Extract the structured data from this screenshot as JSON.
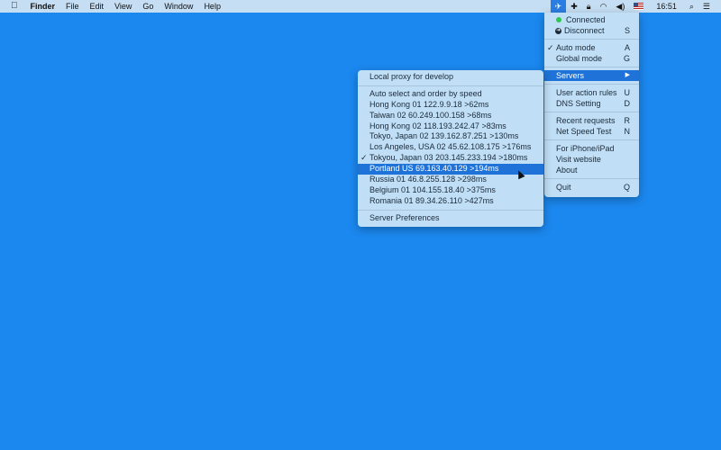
{
  "menubar": {
    "apple": "",
    "app": "Finder",
    "items": [
      "File",
      "Edit",
      "View",
      "Go",
      "Window",
      "Help"
    ],
    "clock": "16:51"
  },
  "status_icons": [
    "shadowsocks-icon",
    "plus-icon",
    "lock-icon",
    "wifi-icon",
    "volume-icon",
    "us-flag-icon",
    "search-icon",
    "list-icon"
  ],
  "main_menu": {
    "connected": "Connected",
    "disconnect": "Disconnect",
    "disconnect_key": "S",
    "auto_mode": "Auto mode",
    "auto_key": "A",
    "global_mode": "Global mode",
    "global_key": "G",
    "servers": "Servers",
    "user_rules": "User action rules",
    "user_key": "U",
    "dns": "DNS Setting",
    "dns_key": "D",
    "recent": "Recent requests",
    "recent_key": "R",
    "speed": "Net Speed Test",
    "speed_key": "N",
    "iphone": "For iPhone/iPad",
    "website": "Visit website",
    "about": "About",
    "quit": "Quit",
    "quit_key": "Q"
  },
  "sub_menu": {
    "local": "Local proxy for develop",
    "auto": "Auto select and order by speed",
    "servers": [
      "Hong Kong 01  122.9.9.18  >62ms",
      "Taiwan 02  60.249.100.158  >68ms",
      "Hong Kong 02  118.193.242.47  >83ms",
      "Tokyo, Japan 02  139.162.87.251  >130ms",
      "Los Angeles, USA 02  45.62.108.175  >176ms",
      "Tokyou, Japan 03  203.145.233.194  >180ms",
      "Portland US  69.163.40.129  >194ms",
      "Russia 01  46.8.255.128  >298ms",
      "Belgium 01  104.155.18.40  >375ms",
      "Romania 01  89.34.26.110  >427ms"
    ],
    "selected": "Tokyou, Japan 03",
    "highlighted": "Portland US",
    "prefs": "Server Preferences"
  },
  "colors": {
    "desktop": "#1b88ef",
    "highlight": "#1f73d8",
    "connected": "#2fc752"
  }
}
